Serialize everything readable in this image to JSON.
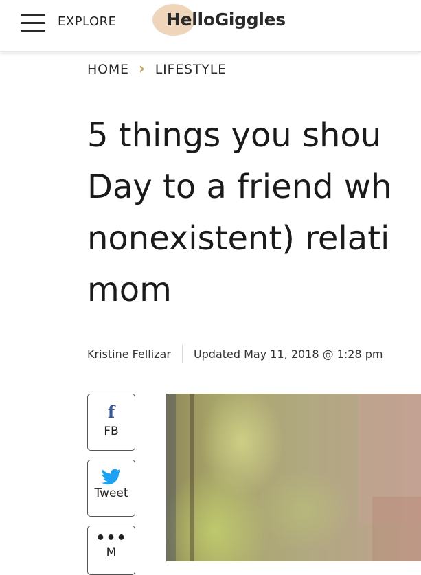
{
  "header": {
    "menu_icon": "hamburger-menu-icon",
    "explore_label": "EXPLORE",
    "logo_text": "HelloGiggles",
    "logo_blob_color": "#efd6ba"
  },
  "breadcrumb": {
    "home": "HOME",
    "separator_icon": "chevron-right-icon",
    "separator_color": "#c9a25c",
    "section": "LIFESTYLE"
  },
  "article": {
    "title_lines": [
      "5 things you shou",
      "Day to a friend wh",
      "nonexistent) relati",
      "mom"
    ],
    "author": "Kristine Fellizar",
    "updated": "Updated May 11, 2018 @ 1:28 pm"
  },
  "share": {
    "facebook": {
      "icon": "facebook-icon",
      "label": "FB",
      "color": "#3b5998"
    },
    "twitter": {
      "icon": "twitter-bird-icon",
      "label": "Tweet",
      "color": "#1da1f2"
    },
    "more": {
      "icon": "ellipsis-icon",
      "label": "M"
    }
  },
  "hero_image": {
    "alt": "article hero photo"
  }
}
